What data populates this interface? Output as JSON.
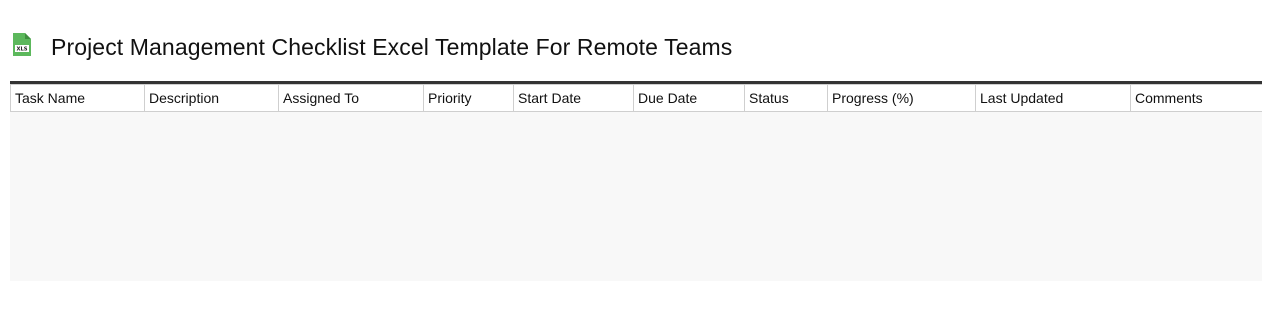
{
  "header": {
    "icon": "xls-file-icon",
    "icon_text": "XLS",
    "title": "Project Management Checklist Excel Template For Remote Teams"
  },
  "table": {
    "columns": [
      "Task Name",
      "Description",
      "Assigned To",
      "Priority",
      "Start Date",
      "Due Date",
      "Status",
      "Progress (%)",
      "Last Updated",
      "Comments"
    ],
    "rows": []
  },
  "colors": {
    "icon_green": "#5cb85c",
    "header_rule": "#333333",
    "sheet_background": "#f8f8f8",
    "cell_border": "#cfcfcf"
  }
}
